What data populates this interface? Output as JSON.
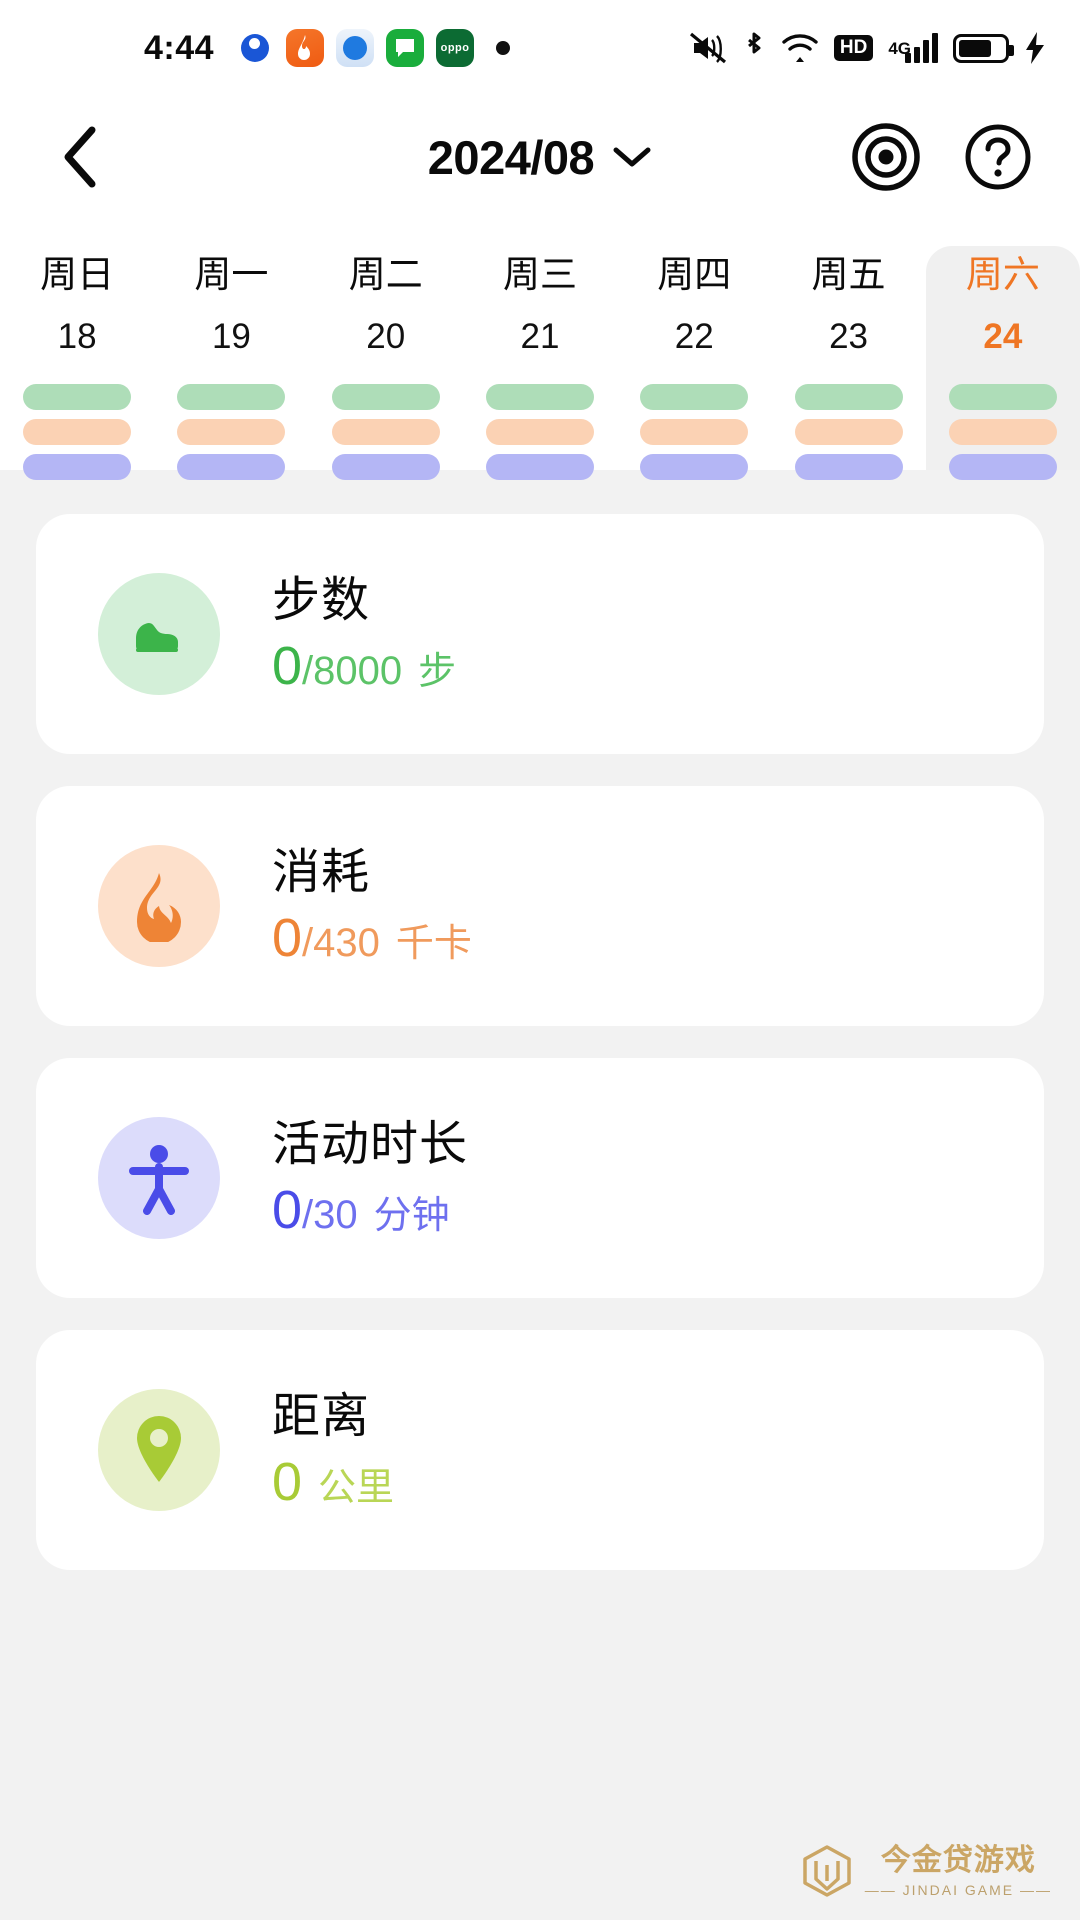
{
  "status_bar": {
    "time": "4:44",
    "app_icons": [
      "browser-icon",
      "fire-app-icon",
      "blue-app-icon",
      "message-app-icon",
      "oppo-app-icon"
    ],
    "notification_dot": "notification-dot",
    "right_icons": [
      "mute-icon",
      "bluetooth-icon",
      "wifi-icon",
      "hd-icon",
      "signal-4g-icon",
      "battery-charging-icon"
    ],
    "hd_label": "HD",
    "network_label": "4G"
  },
  "header": {
    "back_icon": "chevron-left-icon",
    "title": "2024/08",
    "dropdown_icon": "chevron-down-icon",
    "target_icon": "target-icon",
    "help_icon": "question-mark-icon"
  },
  "week": {
    "days": [
      {
        "dow": "周日",
        "date": "18",
        "selected": false
      },
      {
        "dow": "周一",
        "date": "19",
        "selected": false
      },
      {
        "dow": "周二",
        "date": "20",
        "selected": false
      },
      {
        "dow": "周三",
        "date": "21",
        "selected": false
      },
      {
        "dow": "周四",
        "date": "22",
        "selected": false
      },
      {
        "dow": "周五",
        "date": "23",
        "selected": false
      },
      {
        "dow": "周六",
        "date": "24",
        "selected": true
      }
    ],
    "bar_colors": [
      "#aeddb8",
      "#fbd2b4",
      "#b4b6f5"
    ],
    "selected_color": "#ef7624",
    "selected_bg": "#f0f0f0"
  },
  "metrics": [
    {
      "id": "steps",
      "title": "步数",
      "icon": "shoe-icon",
      "value": "0",
      "goal": "/8000",
      "unit": "步",
      "color": "#3cb44a",
      "icon_bg": "#d3efd8"
    },
    {
      "id": "calories",
      "title": "消耗",
      "icon": "flame-icon",
      "value": "0",
      "goal": "/430",
      "unit": "千卡",
      "color": "#ee8436",
      "icon_bg": "#fde0cb"
    },
    {
      "id": "active-duration",
      "title": "活动时长",
      "icon": "person-active-icon",
      "value": "0",
      "goal": "/30",
      "unit": "分钟",
      "color": "#4a4ce8",
      "icon_bg": "#dcdcfb"
    },
    {
      "id": "distance",
      "title": "距离",
      "icon": "map-pin-icon",
      "value": "0",
      "goal": "",
      "unit": "公里",
      "color": "#a8cb36",
      "icon_bg": "#e7f0c9"
    }
  ],
  "watermark": {
    "logo_icon": "jindai-logo-icon",
    "main": "今金贷游戏",
    "sub": "—— JINDAI GAME ——"
  }
}
